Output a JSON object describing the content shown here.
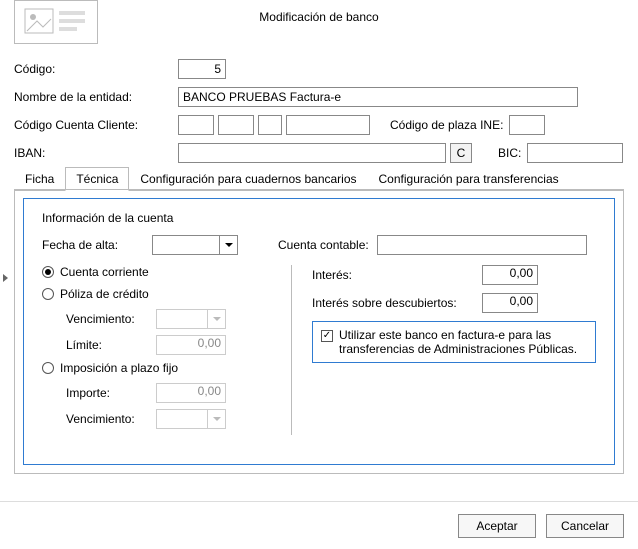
{
  "title": "Modificación de banco",
  "top": {
    "codigo_label": "Código:",
    "codigo_value": "5",
    "nombre_label": "Nombre de la entidad:",
    "nombre_value": "BANCO PRUEBAS Factura-e",
    "ccc_label": "Código Cuenta Cliente:",
    "ccc_1": "",
    "ccc_2": "",
    "ccc_3": "",
    "ccc_4": "",
    "ine_label": "Código de plaza INE:",
    "ine_value": "",
    "iban_label": "IBAN:",
    "iban_value": "",
    "iban_btn": "C",
    "bic_label": "BIC:",
    "bic_value": ""
  },
  "tabs": {
    "t0": "Ficha",
    "t1": "Técnica",
    "t2": "Configuración para cuadernos bancarios",
    "t3": "Configuración para transferencias"
  },
  "tech": {
    "section_title": "Información de la cuenta",
    "fecha_alta_label": "Fecha de alta:",
    "fecha_alta_value": "",
    "cuenta_contable_label": "Cuenta contable:",
    "cuenta_contable_value": "",
    "r_cc": "Cuenta corriente",
    "r_pc": "Póliza de crédito",
    "pc_venc_label": "Vencimiento:",
    "pc_venc_value": "",
    "pc_limite_label": "Límite:",
    "pc_limite_value": "0,00",
    "r_ip": "Imposición a plazo fijo",
    "ip_importe_label": "Importe:",
    "ip_importe_value": "0,00",
    "ip_venc_label": "Vencimiento:",
    "ip_venc_value": "",
    "interes_label": "Interés:",
    "interes_value": "0,00",
    "interes_desc_label": "Interés sobre descubiertos:",
    "interes_desc_value": "0,00",
    "chk_label": "Utilizar este banco en factura-e para las transferencias de Administraciones Públicas."
  },
  "footer": {
    "ok": "Aceptar",
    "cancel": "Cancelar"
  }
}
